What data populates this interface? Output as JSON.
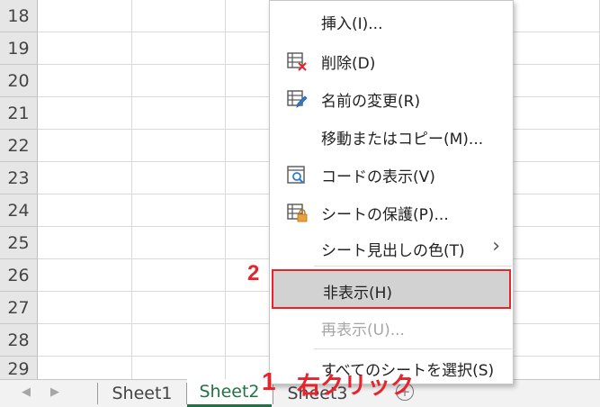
{
  "rows": [
    "18",
    "19",
    "20",
    "21",
    "22",
    "23",
    "24",
    "25",
    "26",
    "27",
    "28",
    "29"
  ],
  "sheet_tabs": [
    {
      "label": "Sheet1",
      "active": false
    },
    {
      "label": "Sheet2",
      "active": true
    },
    {
      "label": "Sheet3",
      "active": false
    }
  ],
  "tab_nav": {
    "prev": "◀",
    "next": "▶"
  },
  "add_sheet_label": "+",
  "context_menu": {
    "items": [
      {
        "label": "挿入(I)...",
        "icon": null,
        "disabled": false
      },
      {
        "label": "削除(D)",
        "icon": "delete-sheet-icon",
        "disabled": false
      },
      {
        "label": "名前の変更(R)",
        "icon": "rename-sheet-icon",
        "disabled": false
      },
      {
        "label": "移動またはコピー(M)...",
        "icon": null,
        "disabled": false
      },
      {
        "label": "コードの表示(V)",
        "icon": "view-code-icon",
        "disabled": false
      },
      {
        "label": "シートの保護(P)...",
        "icon": "protect-sheet-icon",
        "disabled": false
      },
      {
        "label": "シート見出しの色(T)",
        "icon": null,
        "disabled": false,
        "submenu": true
      },
      {
        "label": "非表示(H)",
        "icon": null,
        "disabled": false,
        "highlighted": true
      },
      {
        "label": "再表示(U)...",
        "icon": null,
        "disabled": true
      },
      {
        "label": "すべてのシートを選択(S)",
        "icon": null,
        "disabled": false
      }
    ],
    "submenu_arrow": "›"
  },
  "annotations": {
    "step1": "1",
    "step1_text": "右クリック",
    "step2": "2"
  },
  "colors": {
    "accent_green": "#217346",
    "highlight_border": "#e8232b",
    "annotation_red": "#e8232b"
  }
}
